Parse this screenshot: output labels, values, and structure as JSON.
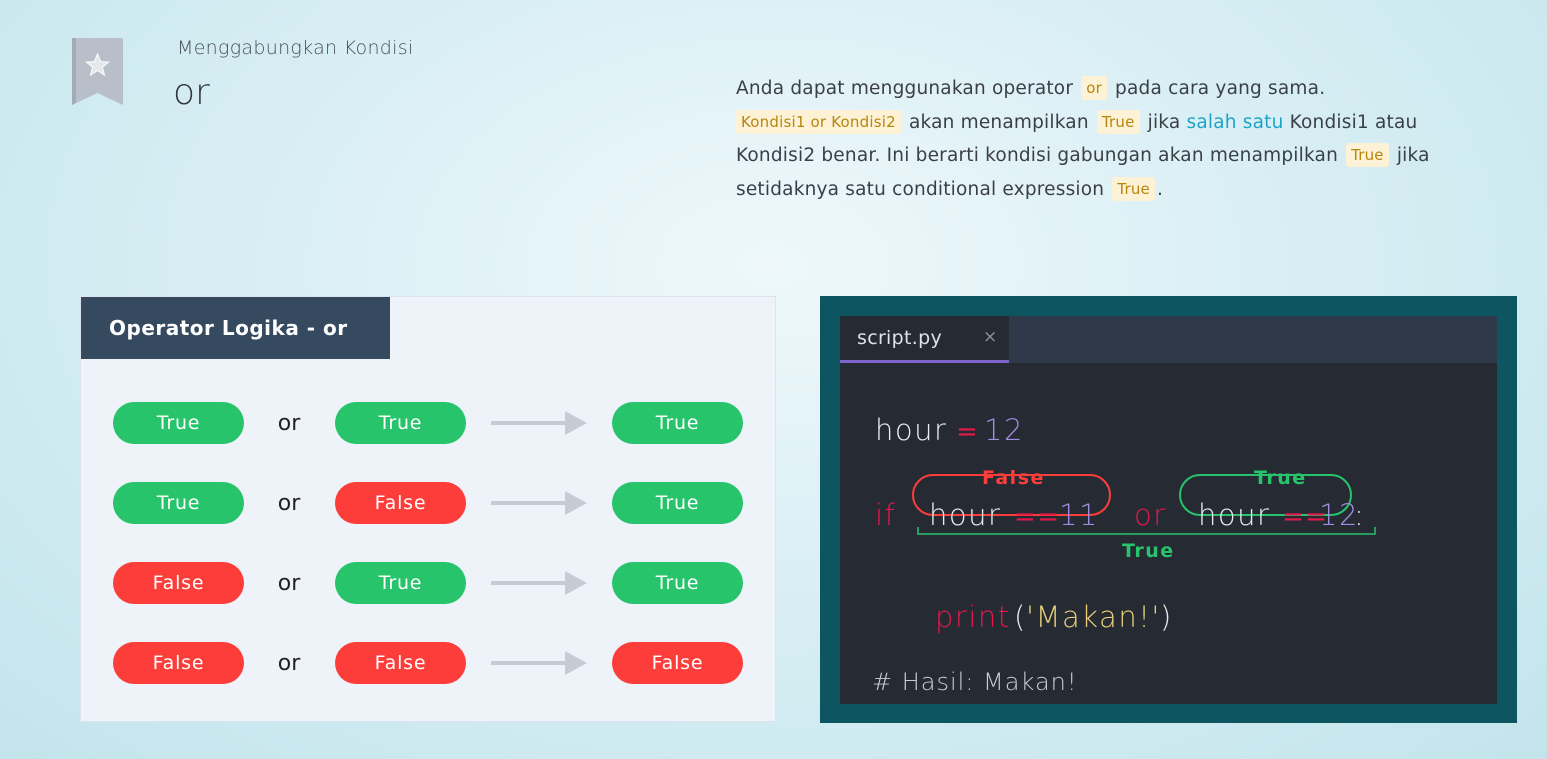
{
  "header": {
    "subtitle": "Menggabungkan Kondisi",
    "title": "or"
  },
  "description": {
    "p1": "Anda dapat menggunakan operator ",
    "code_or": "or",
    "p2": " pada cara yang sama.",
    "code_expr": "Kondisi1 or Kondisi2",
    "p3": " akan menampilkan ",
    "code_true_1": "True",
    "p4": " jika ",
    "highlight": "salah satu",
    "p5": " Kondisi1 atau Kondisi2 benar. Ini berarti kondisi gabungan akan menampilkan ",
    "code_true_2": "True",
    "p6": " jika setidaknya satu conditional expression ",
    "code_true_3": "True",
    "p7": "."
  },
  "truth_table": {
    "title": "Operator Logika - or",
    "operator": "or",
    "rows": [
      {
        "left": "True",
        "right": "True",
        "result": "True"
      },
      {
        "left": "True",
        "right": "False",
        "result": "True"
      },
      {
        "left": "False",
        "right": "True",
        "result": "True"
      },
      {
        "left": "False",
        "right": "False",
        "result": "False"
      }
    ]
  },
  "editor": {
    "tab_name": "script.py",
    "tab_close": "×",
    "line1": {
      "var": "hour",
      "eq": "=",
      "num": "12"
    },
    "annot_false": "False",
    "annot_true": "True",
    "line2": {
      "kw_if": "if",
      "var1": "hour",
      "eqeq1": "==",
      "num1": "11",
      "kw_or": "or",
      "var2": "hour",
      "eqeq2": "==",
      "num2": "12",
      "colon": ":"
    },
    "annot_combined": "True",
    "line3": {
      "fn": "print",
      "open": "(",
      "str": "'Makan!'",
      "close": ")"
    },
    "comment": "# Hasil: Makan!"
  },
  "colors": {
    "true_pill": "#27c46c",
    "false_pill": "#fd3d3a",
    "header_bg": "#354a5e",
    "editor_bg": "#262a33",
    "frame_bg": "#0e5562",
    "keyword": "#e6194b",
    "number": "#a08ce0",
    "string": "#e8cf7a"
  }
}
